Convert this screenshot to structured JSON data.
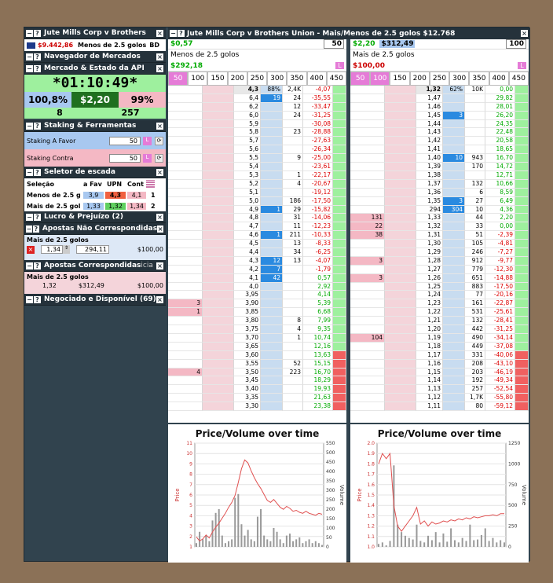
{
  "window": {
    "title": "Jute Mills Corp v Brothers",
    "balance": "$9.442,86",
    "market_short": "Menos de 2.5 golos",
    "market_code": "BD"
  },
  "sidebar": {
    "navigator": "Navegador de Mercados",
    "api_panel": "Mercado & Estado da API",
    "timer": "*01:10:49*",
    "back_pct": "100,8%",
    "matched": "$2,20",
    "lay_pct": "99%",
    "count_back": "8",
    "count_lay": "257",
    "staking": "Staking & Ferramentas",
    "stake_back_label": "Staking A Favor",
    "stake_back_val": "50",
    "stake_lay_label": "Staking Contra",
    "stake_lay_val": "50",
    "selector": "Seletor de escada",
    "sel_headers": [
      "Seleção",
      "a Fav",
      "UPN",
      "Cont"
    ],
    "sel_rows": [
      {
        "name": "Menos de 2.5 g",
        "fav": "3,9",
        "upn": "4,3",
        "cont": "4,1",
        "n": "1"
      },
      {
        "name": "Mais de 2.5 gol",
        "fav": "1,33",
        "upn": "1,32",
        "cont": "1,34",
        "n": "2"
      }
    ],
    "pnl": "Lucro & Prejuízo (2)",
    "unmatched": "Apostas Não Correspondidas",
    "unmatched_sel": "Mais de 2.5 golos",
    "unmatched_odds": "1,34",
    "unmatched_stake": "294,11",
    "unmatched_amount": "$100,00",
    "matched_bets": "Apostas Correspondidas",
    "matched_suffix": "icia",
    "matched_sel": "Mais de 2.5 golos",
    "matched_odds": "1,32",
    "matched_profit": "$312,49",
    "matched_amount": "$100,00",
    "traded": "Negociado e Disponível (69)"
  },
  "ladder_title": "Jute Mills Corp v Brothers Union - Mais/Menos de 2.5 golos  $12.768",
  "ladder1": {
    "pl": "$0,57",
    "stake": "50",
    "name": "Menos de 2.5 golos",
    "pl2": "$292,18",
    "L": "L",
    "ticks": [
      "50",
      "100",
      "150",
      "200",
      "250",
      "300",
      "350",
      "400",
      "450"
    ]
  },
  "ladder2": {
    "pl": "$2,20",
    "pl_b": "$312,49",
    "stake": "100",
    "name": "Mais de 2.5 golos",
    "pl2": "$100,00",
    "L": "L",
    "ticks": [
      "50",
      "100",
      "150",
      "200",
      "250",
      "300",
      "350",
      "400",
      "450"
    ]
  },
  "ladder1_rows": [
    [
      "",
      "4,3",
      "88%",
      "2,4K",
      "-4,07"
    ],
    [
      "",
      "6,4",
      "19",
      "24",
      "-35,55"
    ],
    [
      "",
      "6,2",
      "",
      "12",
      "-33,47"
    ],
    [
      "",
      "6,0",
      "",
      "24",
      "-31,25"
    ],
    [
      "",
      "5,9",
      "",
      "",
      "-30,08"
    ],
    [
      "",
      "5,8",
      "",
      "23",
      "-28,88"
    ],
    [
      "",
      "5,7",
      "",
      "",
      "-27,63"
    ],
    [
      "",
      "5,6",
      "",
      "",
      "-26,34"
    ],
    [
      "",
      "5,5",
      "",
      "9",
      "-25,00"
    ],
    [
      "",
      "5,4",
      "",
      "",
      "-23,61"
    ],
    [
      "",
      "5,3",
      "",
      "1",
      "-22,17"
    ],
    [
      "",
      "5,2",
      "",
      "4",
      "-20,67"
    ],
    [
      "",
      "5,1",
      "",
      "",
      "-19,12"
    ],
    [
      "",
      "5,0",
      "",
      "186",
      "-17,50"
    ],
    [
      "",
      "4,9",
      "1",
      "29",
      "-15,82"
    ],
    [
      "",
      "4,8",
      "",
      "31",
      "-14,06"
    ],
    [
      "",
      "4,7",
      "",
      "11",
      "-12,23"
    ],
    [
      "",
      "4,6",
      "1",
      "211",
      "-10,33"
    ],
    [
      "",
      "4,5",
      "",
      "13",
      "-8,33"
    ],
    [
      "",
      "4,4",
      "",
      "34",
      "-6,25"
    ],
    [
      "",
      "4,3",
      "12",
      "13",
      "-4,07"
    ],
    [
      "",
      "4,2",
      "7",
      "",
      "-1,79"
    ],
    [
      "",
      "4,1",
      "42",
      "",
      "0,57"
    ],
    [
      "",
      "4,0",
      "",
      "",
      "2,92"
    ],
    [
      "",
      "3,95",
      "",
      "",
      "4,14"
    ],
    [
      "3",
      "3,90",
      "",
      "",
      "5,39"
    ],
    [
      "1",
      "3,85",
      "",
      "",
      "6,68"
    ],
    [
      "",
      "3,80",
      "",
      "8",
      "7,99"
    ],
    [
      "",
      "3,75",
      "",
      "4",
      "9,35"
    ],
    [
      "",
      "3,70",
      "",
      "1",
      "10,74"
    ],
    [
      "",
      "3,65",
      "",
      "",
      "12,16"
    ],
    [
      "",
      "3,60",
      "",
      "",
      "13,63"
    ],
    [
      "",
      "3,55",
      "",
      "52",
      "15,15"
    ],
    [
      "4",
      "3,50",
      "",
      "223",
      "16,70"
    ],
    [
      "",
      "3,45",
      "",
      "",
      "18,29"
    ],
    [
      "",
      "3,40",
      "",
      "",
      "19,93"
    ],
    [
      "",
      "3,35",
      "",
      "",
      "21,63"
    ],
    [
      "",
      "3,30",
      "",
      "",
      "23,38"
    ]
  ],
  "ladder2_rows": [
    [
      "",
      "1,32",
      "62%",
      "10K",
      "0,00"
    ],
    [
      "",
      "1,47",
      "",
      "",
      "29,82"
    ],
    [
      "",
      "1,46",
      "",
      "",
      "28,01"
    ],
    [
      "",
      "1,45",
      "3",
      "",
      "26,20"
    ],
    [
      "",
      "1,44",
      "",
      "",
      "24,35"
    ],
    [
      "",
      "1,43",
      "",
      "",
      "22,48"
    ],
    [
      "",
      "1,42",
      "",
      "",
      "20,58"
    ],
    [
      "",
      "1,41",
      "",
      "",
      "18,65"
    ],
    [
      "",
      "1,40",
      "10",
      "943",
      "16,70"
    ],
    [
      "",
      "1,39",
      "",
      "170",
      "14,72"
    ],
    [
      "",
      "1,38",
      "",
      "",
      "12,71"
    ],
    [
      "",
      "1,37",
      "",
      "132",
      "10,66"
    ],
    [
      "",
      "1,36",
      "",
      "6",
      "8,59"
    ],
    [
      "",
      "1,35",
      "3",
      "27",
      "6,49"
    ],
    [
      "",
      "294",
      "304",
      "10",
      "4,36"
    ],
    [
      "131",
      "1,33",
      "",
      "44",
      "2,20"
    ],
    [
      "22",
      "1,32",
      "",
      "33",
      "0,00"
    ],
    [
      "38",
      "1,31",
      "",
      "51",
      "-2,39"
    ],
    [
      "",
      "1,30",
      "",
      "105",
      "-4,81"
    ],
    [
      "",
      "1,29",
      "",
      "246",
      "-7,27"
    ],
    [
      "3",
      "1,28",
      "",
      "912",
      "-9,77"
    ],
    [
      "",
      "1,27",
      "",
      "779",
      "-12,30"
    ],
    [
      "3",
      "1,26",
      "",
      "651",
      "-14,88"
    ],
    [
      "",
      "1,25",
      "",
      "883",
      "-17,50"
    ],
    [
      "",
      "1,24",
      "",
      "77",
      "-20,16"
    ],
    [
      "",
      "1,23",
      "",
      "161",
      "-22,87"
    ],
    [
      "",
      "1,22",
      "",
      "531",
      "-25,61"
    ],
    [
      "",
      "1,21",
      "",
      "132",
      "-28,41"
    ],
    [
      "",
      "1,20",
      "",
      "442",
      "-31,25"
    ],
    [
      "104",
      "1,19",
      "",
      "490",
      "-34,14"
    ],
    [
      "",
      "1,18",
      "",
      "449",
      "-37,08"
    ],
    [
      "",
      "1,17",
      "",
      "331",
      "-40,06"
    ],
    [
      "",
      "1,16",
      "",
      "208",
      "-43,10"
    ],
    [
      "",
      "1,15",
      "",
      "203",
      "-46,19"
    ],
    [
      "",
      "1,14",
      "",
      "192",
      "-49,34"
    ],
    [
      "",
      "1,13",
      "",
      "257",
      "-52,54"
    ],
    [
      "",
      "1,12",
      "",
      "1,7K",
      "-55,80"
    ],
    [
      "",
      "1,11",
      "",
      "80",
      "-59,12"
    ]
  ],
  "chart1": {
    "title": "Price/Volume over time",
    "ylabel": "Price",
    "y2label": "Volume",
    "yticks": [
      "1",
      "2",
      "3",
      "4",
      "5",
      "6",
      "7",
      "8",
      "9",
      "10",
      "11"
    ],
    "y2ticks": [
      "0",
      "50",
      "100",
      "150",
      "200",
      "250",
      "300",
      "350",
      "400",
      "450",
      "500",
      "550"
    ]
  },
  "chart2": {
    "title": "Price/Volume over time",
    "ylabel": "Price",
    "y2label": "Volume",
    "yticks": [
      "1.0",
      "1.1",
      "1.2",
      "1.3",
      "1.4",
      "1.5",
      "1.6",
      "1.7",
      "1.8",
      "1.9",
      "2.0"
    ],
    "y2ticks": [
      "0",
      "250",
      "500",
      "750",
      "1000",
      "1250"
    ]
  },
  "chart_data": [
    {
      "type": "line",
      "title": "Price/Volume over time",
      "ylabel": "Price",
      "y2label": "Volume",
      "ylim": [
        1,
        11.5
      ],
      "y2lim": [
        0,
        550
      ],
      "series": [
        {
          "values": [
            2.0,
            1.6,
            1.8,
            2.2,
            1.9,
            2.5,
            3.0,
            3.4,
            3.9,
            4.4,
            5.0,
            5.5,
            6.2,
            7.5,
            8.9,
            9.8,
            9.5,
            8.7,
            8.0,
            7.4,
            6.9,
            6.3,
            5.7,
            5.5,
            5.8,
            5.4,
            5.0,
            4.8,
            5.1,
            4.9,
            4.6,
            4.7,
            4.5,
            4.4,
            4.6,
            4.4,
            4.3,
            4.2,
            4.4,
            4.3
          ]
        }
      ],
      "volume": [
        20,
        80,
        40,
        60,
        30,
        140,
        180,
        200,
        60,
        20,
        30,
        40,
        260,
        280,
        120,
        60,
        90,
        40,
        30,
        160,
        200,
        60,
        40,
        30,
        100,
        80,
        40,
        20,
        60,
        70,
        30,
        40,
        50,
        20,
        30,
        40,
        20,
        30,
        20,
        10
      ]
    },
    {
      "type": "line",
      "title": "Price/Volume over time",
      "ylabel": "Price",
      "y2label": "Volume",
      "ylim": [
        1,
        2.0
      ],
      "y2lim": [
        0,
        1400
      ],
      "series": [
        {
          "values": [
            1.8,
            1.9,
            1.85,
            1.9,
            1.4,
            1.2,
            1.15,
            1.2,
            1.25,
            1.3,
            1.38,
            1.22,
            1.25,
            1.2,
            1.24,
            1.22,
            1.23,
            1.25,
            1.24,
            1.26,
            1.25,
            1.27,
            1.26,
            1.28,
            1.27,
            1.29,
            1.28,
            1.29,
            1.3,
            1.3,
            1.31,
            1.3,
            1.32,
            1.32
          ]
        }
      ],
      "volume": [
        40,
        60,
        20,
        80,
        1100,
        300,
        200,
        150,
        120,
        100,
        300,
        80,
        60,
        150,
        90,
        200,
        60,
        180,
        70,
        250,
        90,
        60,
        120,
        80,
        300,
        90,
        100,
        160,
        250,
        80,
        120,
        60,
        90,
        60
      ]
    }
  ]
}
